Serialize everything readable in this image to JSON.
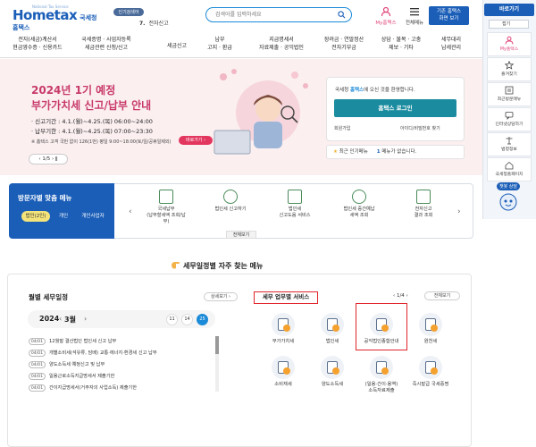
{
  "header": {
    "logo_text": "Hometax",
    "logo_sub": "국세청홈택스",
    "logo_tiny": "National Tax Service",
    "popular_badge": "인기검색어",
    "popular_rank": "7.",
    "popular_term": "전자신고",
    "search_placeholder": "검색어를 입력하세요",
    "my_hometax": "My홈택스",
    "all_menu": "전체메뉴",
    "corp_btn_line1": "기존 홈택스",
    "corp_btn_line2": "화면 보기"
  },
  "nav": [
    {
      "l1": "전자(세금)계산서",
      "l2": "현금영수증 · 신용카드"
    },
    {
      "l1": "국세증명 · 사업자등록",
      "l2": "세금관련 신청/신고"
    },
    {
      "l1": "세금신고",
      "l2": ""
    },
    {
      "l1": "납부",
      "l2": "고지 · 환급"
    },
    {
      "l1": "지급명세서",
      "l2": "자료제출 · 공익법인"
    },
    {
      "l1": "장려금 · 연말정산",
      "l2": "전자기부금"
    },
    {
      "l1": "상담 · 불복 · 고충",
      "l2": "제보 · 기타"
    },
    {
      "l1": "세무대리",
      "l2": "납세관리"
    }
  ],
  "right_bar": {
    "title": "바로가기",
    "select": "접기",
    "items": [
      "My홈택스",
      "즐겨찾기",
      "최근방문메뉴",
      "인터넷상담하기",
      "법령정보",
      "국세청홈페이지"
    ],
    "chatbot": "챗봇 상담"
  },
  "banner": {
    "title_line1": "2024년 1기 예정",
    "title_line2": "부가가치세 신고/납부 안내",
    "period1": "· 신고기간 : 4.1.(월)~4.25.(목) 06:00~24:00",
    "period2": "· 납부기한 : 4.1.(월)~4.25.(목) 07:00~23:30",
    "note": "※ 홈택스 고객 국번 없이 126(1번) 평일 9:00~18:00(토/일/공휴일제외)",
    "detail_btn": "바로가기 ›",
    "pager": "‹  1/5  ›  ǁ"
  },
  "login": {
    "welcome_pre": "국세청 ",
    "welcome_brand": "홈택스",
    "welcome_post": "에 오신 것을 환영합니다.",
    "button": "홈택스 로그인",
    "signup": "회원가입",
    "find": "아이디/비밀번호 찾기"
  },
  "popular_menu": {
    "label": "최근 인기메뉴",
    "count": "1",
    "text": "메뉴가 없습니다."
  },
  "visitor": {
    "title": "방문자별 맞춤 메뉴",
    "tabs": [
      "법인(2인)",
      "개인",
      "개인사업자"
    ],
    "items": [
      {
        "l1": "국세납부",
        "l2": "(납부할세액 조회/납부)"
      },
      {
        "l1": "법인세 신고하기",
        "l2": ""
      },
      {
        "l1": "법인세",
        "l2": "신고도움 서비스"
      },
      {
        "l1": "법인세 중간예납",
        "l2": "세액 조회"
      },
      {
        "l1": "전자신고",
        "l2": "결과 조회"
      }
    ],
    "all_btn": "전체보기",
    "prev": "‹",
    "next": "›"
  },
  "frequent": {
    "title": "세무일정별 자주 찾는 메뉴"
  },
  "schedule": {
    "title": "월별 세무일정",
    "more": "상세보기 ›",
    "year": "2024",
    "month": "3월",
    "days": [
      "11",
      "14",
      "25"
    ],
    "rows": [
      {
        "date": "04/01",
        "text": "12월말 결산법인 법인세 신고 납부"
      },
      {
        "date": "04/01",
        "text": "개별소비세(석유류, 담배) 교통·에너지·환경세 신고 납부"
      },
      {
        "date": "04/01",
        "text": "양도소득세 예정신고 및 납부"
      },
      {
        "date": "04/01",
        "text": "일용근로소득지급명세서 제출기한"
      },
      {
        "date": "04/01",
        "text": "간이지급명세서(거주자의 사업소득) 제출기한"
      }
    ]
  },
  "services": {
    "title": "세무 업무별 서비스",
    "pager": "‹  1/4  ›",
    "all": "전체보기",
    "items": [
      {
        "l1": "부가가치세",
        "l2": ""
      },
      {
        "l1": "법인세",
        "l2": ""
      },
      {
        "l1": "공익법인종합안내",
        "l2": ""
      },
      {
        "l1": "원천세",
        "l2": ""
      },
      {
        "l1": "소비재세",
        "l2": ""
      },
      {
        "l1": "양도소득세",
        "l2": ""
      },
      {
        "l1": "(일용·간이·용역)",
        "l2": "소득자료제출"
      },
      {
        "l1": "즉시발급 국세증명",
        "l2": ""
      }
    ]
  }
}
